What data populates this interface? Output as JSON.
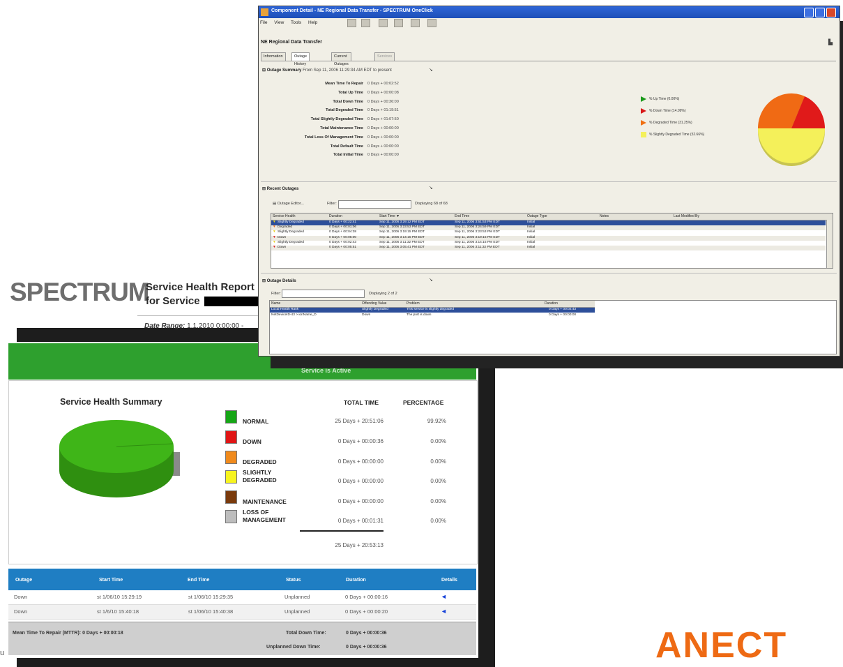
{
  "report": {
    "logo": "SPECTRUM",
    "title_line1": "Service Health Report",
    "title_line2": "for Service",
    "date_range_label": "Date Range:",
    "date_range_value": "1.1.2010  0:00:00  -",
    "green_bar_text": "Service is Active",
    "summary_title": "Service Health Summary",
    "col_total_time": "TOTAL TIME",
    "col_percentage": "PERCENTAGE",
    "legend": [
      {
        "label": "NORMAL",
        "time": "25 Days + 20:51:06",
        "pct": "99.92%",
        "color": "#16a616"
      },
      {
        "label": "DOWN",
        "time": "0 Days + 00:00:36",
        "pct": "0.00%",
        "color": "#e01515"
      },
      {
        "label": "DEGRADED",
        "time": "0 Days + 00:00:00",
        "pct": "0.00%",
        "color": "#f08a1c"
      },
      {
        "label": "SLIGHTLY\nDEGRADED",
        "time": "0 Days + 00:00:00",
        "pct": "0.00%",
        "color": "#f7f41e"
      },
      {
        "label": "MAINTENANCE",
        "time": "0 Days + 00:00:00",
        "pct": "0.00%",
        "color": "#7a3a0c"
      },
      {
        "label": "LOSS OF\nMANAGEMENT",
        "time": "0 Days + 00:01:31",
        "pct": "0.00%",
        "color": "#bdbdbd"
      }
    ],
    "grand_total": "25 Days + 20:53:13",
    "outages": {
      "headers": [
        "Outage",
        "Start Time",
        "End Time",
        "Status",
        "Duration",
        "Details"
      ],
      "rows": [
        [
          "Down",
          "st 1/06/10  15:29:19",
          "st 1/06/10 15:29:35",
          "Unplanned",
          "0 Days + 00:00:16"
        ],
        [
          "Down",
          "st 1/6/10  15:40:18",
          "st 1/06/10 15:40:38",
          "Unplanned",
          "0 Days + 00:00:20"
        ]
      ],
      "mttr": "Mean Time To Repair (MTTR):  0 Days + 00:00:18",
      "total_down_label": "Total Down Time:",
      "total_down_value": "0 Days + 00:00:36",
      "unplanned_label": "Unplanned Down Time:",
      "unplanned_value": "0 Days + 00:00:36"
    },
    "pie_colors": {
      "normal": "#3fb518",
      "normal_dark": "#2f8f10",
      "loss": "#8a8a8a"
    }
  },
  "window": {
    "title": "Component Detail - NE Regional Data Transfer - SPECTRUM OneClick",
    "menu": [
      "File",
      "View",
      "Tools",
      "Help"
    ],
    "ne_title": "NE Regional Data Transfer",
    "tabs": [
      "Information",
      "Outage History",
      "Current Outages",
      "Services"
    ],
    "outage_summary": {
      "header": "Outage Summary",
      "sub": "From Sep 11, 2006 11:29:34 AM EDT to present",
      "rows": [
        {
          "label": "Mean Time To Repair",
          "value": "0 Days + 00:02:52"
        },
        {
          "label": "Total Up Time",
          "value": "0 Days + 00:00:08"
        },
        {
          "label": "Total Down Time",
          "value": "0 Days + 00:36:00"
        },
        {
          "label": "Total Degraded Time",
          "value": "0 Days + 01:19:51"
        },
        {
          "label": "Total Slightly Degraded Time",
          "value": "0 Days + 01:07:50"
        },
        {
          "label": "Total Maintenance Time",
          "value": "0 Days + 00:00:00"
        },
        {
          "label": "Total Loss Of Management Time",
          "value": "0 Days + 00:00:00"
        },
        {
          "label": "Total Default Time",
          "value": "0 Days + 00:00:00"
        },
        {
          "label": "Total Initial Time",
          "value": "0 Days + 00:00:00"
        }
      ],
      "legend": [
        {
          "text": "% Up Time (0.00%)",
          "color": "#1a9a1a"
        },
        {
          "text": "% Down Time (14.09%)",
          "color": "#d81818"
        },
        {
          "text": "% Degraded Time (31.25%)",
          "color": "#f07014"
        },
        {
          "text": "% Slightly Degraded Time (52.66%)",
          "color": "#f4f05a"
        }
      ]
    },
    "recent_outages": {
      "header": "Recent Outages",
      "outage_editor": "Outage Editor...",
      "filter_label": "Filter:",
      "displaying": "Displaying 68 of 68",
      "columns": [
        "Service Health",
        "Duration",
        "Start Time",
        "End Time",
        "Outage Type",
        "Notes",
        "Last Modified By"
      ],
      "rows": [
        [
          "Slightly Degraded",
          "0 Days + 00:22:41",
          "Sep 11, 2006 3:29:12 PM EDT",
          "Sep 11, 2006 3:51:53 PM EDT",
          "Initial"
        ],
        [
          "Degraded",
          "0 Days + 00:01:06",
          "Sep 11, 2006 3:23:53 PM EDT",
          "Sep 11, 2006 3:24:59 PM EDT",
          "Initial"
        ],
        [
          "Slightly Degraded",
          "0 Days + 00:04:38",
          "Sep 11, 2006 3:19:15 PM EDT",
          "Sep 11, 2006 3:23:53 PM EDT",
          "Initial"
        ],
        [
          "Down",
          "0 Days + 00:05:00",
          "Sep 11, 2006 3:14:15 PM EDT",
          "Sep 11, 2006 3:19:15 PM EDT",
          "Initial"
        ],
        [
          "Slightly Degraded",
          "0 Days + 00:02:43",
          "Sep 11, 2006 3:11:32 PM EDT",
          "Sep 11, 2006 3:14:15 PM EDT",
          "Initial"
        ],
        [
          "Down",
          "0 Days + 00:05:51",
          "Sep 11, 2006 3:05:41 PM EDT",
          "Sep 11, 2006 3:11:32 PM EDT",
          "Initial"
        ]
      ]
    },
    "outage_details": {
      "header": "Outage Details",
      "filter_label": "Filter:",
      "displaying": "Displaying 2 of 2",
      "columns": [
        "Name",
        "Offending Value",
        "Problem",
        "Duration"
      ],
      "rows": [
        [
          "Local Health Rank",
          "Slightly Degraded",
          "This service is slightly degraded",
          "0 Days + 00:02:43"
        ],
        [
          "NetDeviceID-43 > ionName_D",
          "Down",
          "The port is down",
          "0 Days + 00:00:00"
        ]
      ]
    }
  },
  "footer_letter": "u",
  "brand": "ANECT"
}
